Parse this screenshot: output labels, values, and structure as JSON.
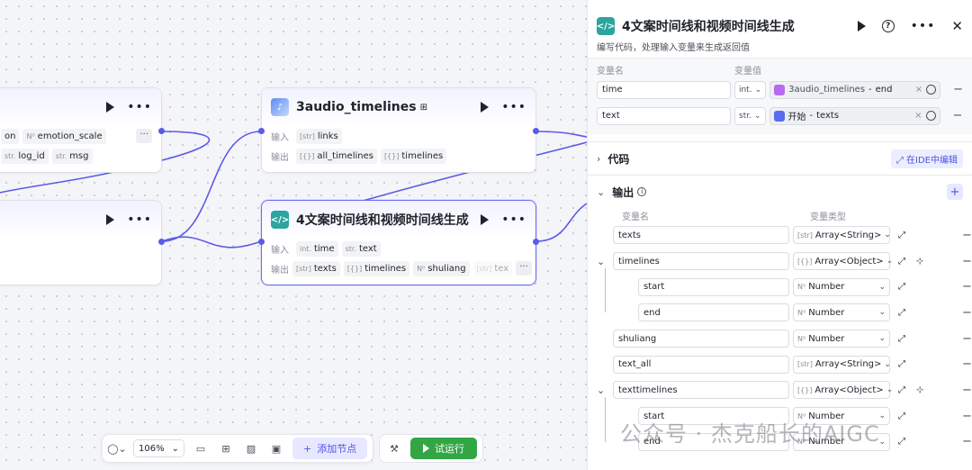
{
  "canvas": {
    "nodes": {
      "left_top": {
        "tags_row1": [
          {
            "type": "",
            "name": "on"
          },
          {
            "type": "N⁰",
            "name": "emotion_scale"
          },
          {
            "type": "",
            "name": ""
          }
        ],
        "tags_row2": [
          {
            "type": "str.",
            "name": "log_id"
          },
          {
            "type": "str.",
            "name": "msg"
          }
        ],
        "more": "···"
      },
      "audio_timelines": {
        "title": "3audio_timelines",
        "input_label": "输入",
        "output_label": "输出",
        "inputs": [
          {
            "type": "[str]",
            "name": "links"
          }
        ],
        "outputs": [
          {
            "type": "[{}]",
            "name": "all_timelines"
          },
          {
            "type": "[{}]",
            "name": "timelines"
          }
        ]
      },
      "code_node": {
        "title": "4文案时间线和视频时间线生成",
        "input_label": "输入",
        "output_label": "输出",
        "inputs": [
          {
            "type": "int.",
            "name": "time"
          },
          {
            "type": "str.",
            "name": "text"
          }
        ],
        "outputs": [
          {
            "type": "[str]",
            "name": "texts"
          },
          {
            "type": "[{}]",
            "name": "timelines"
          },
          {
            "type": "N⁰",
            "name": "shuliang"
          },
          {
            "type": "[str]",
            "name": "tex"
          }
        ],
        "more": "···"
      }
    }
  },
  "toolbar": {
    "zoom": "106%",
    "add_node": "添加节点",
    "run": "试运行"
  },
  "panel": {
    "title": "4文案时间线和视频时间线生成",
    "subtitle": "编写代码，处理输入变量来生成返回值",
    "input_headers": {
      "name": "变量名",
      "value": "变量值"
    },
    "inputs": [
      {
        "name": "time",
        "type": "int.",
        "ref_node": "3audio_timelines",
        "ref_field": "end",
        "ref_color": "#b769f2"
      },
      {
        "name": "text",
        "type": "str.",
        "ref_node": "开始",
        "ref_field": "texts",
        "ref_color": "#5b6cf0"
      }
    ],
    "code_section": {
      "label": "代码",
      "ide_button": "在IDE中编辑"
    },
    "output_section": {
      "label": "输出",
      "headers": {
        "name": "变量名",
        "type": "变量类型"
      },
      "rows": [
        {
          "name": "texts",
          "type_icon": "[str]",
          "type": "Array<String>",
          "level": 0,
          "expandable": false,
          "add_child": false
        },
        {
          "name": "timelines",
          "type_icon": "[{}]",
          "type": "Array<Object>",
          "level": 0,
          "expandable": true,
          "add_child": true
        },
        {
          "name": "start",
          "type_icon": "N⁰",
          "type": "Number",
          "level": 1,
          "expandable": false,
          "add_child": false
        },
        {
          "name": "end",
          "type_icon": "N⁰",
          "type": "Number",
          "level": 1,
          "expandable": false,
          "add_child": false
        },
        {
          "name": "shuliang",
          "type_icon": "N⁰",
          "type": "Number",
          "level": 0,
          "expandable": false,
          "add_child": false
        },
        {
          "name": "text_all",
          "type_icon": "[str]",
          "type": "Array<String>",
          "level": 0,
          "expandable": false,
          "add_child": false
        },
        {
          "name": "texttimelines",
          "type_icon": "[{}]",
          "type": "Array<Object>",
          "level": 0,
          "expandable": true,
          "add_child": true
        },
        {
          "name": "start",
          "type_icon": "N⁰",
          "type": "Number",
          "level": 1,
          "expandable": false,
          "add_child": false
        },
        {
          "name": "end",
          "type_icon": "N⁰",
          "type": "Number",
          "level": 1,
          "expandable": false,
          "add_child": false
        }
      ]
    }
  },
  "watermark": "公众号 · 杰克船长的AIGC",
  "colors": {
    "accent": "#4d53e8",
    "edge": "#5a5ce6",
    "run": "#32a645",
    "code_icon": "#2aa5a0"
  }
}
